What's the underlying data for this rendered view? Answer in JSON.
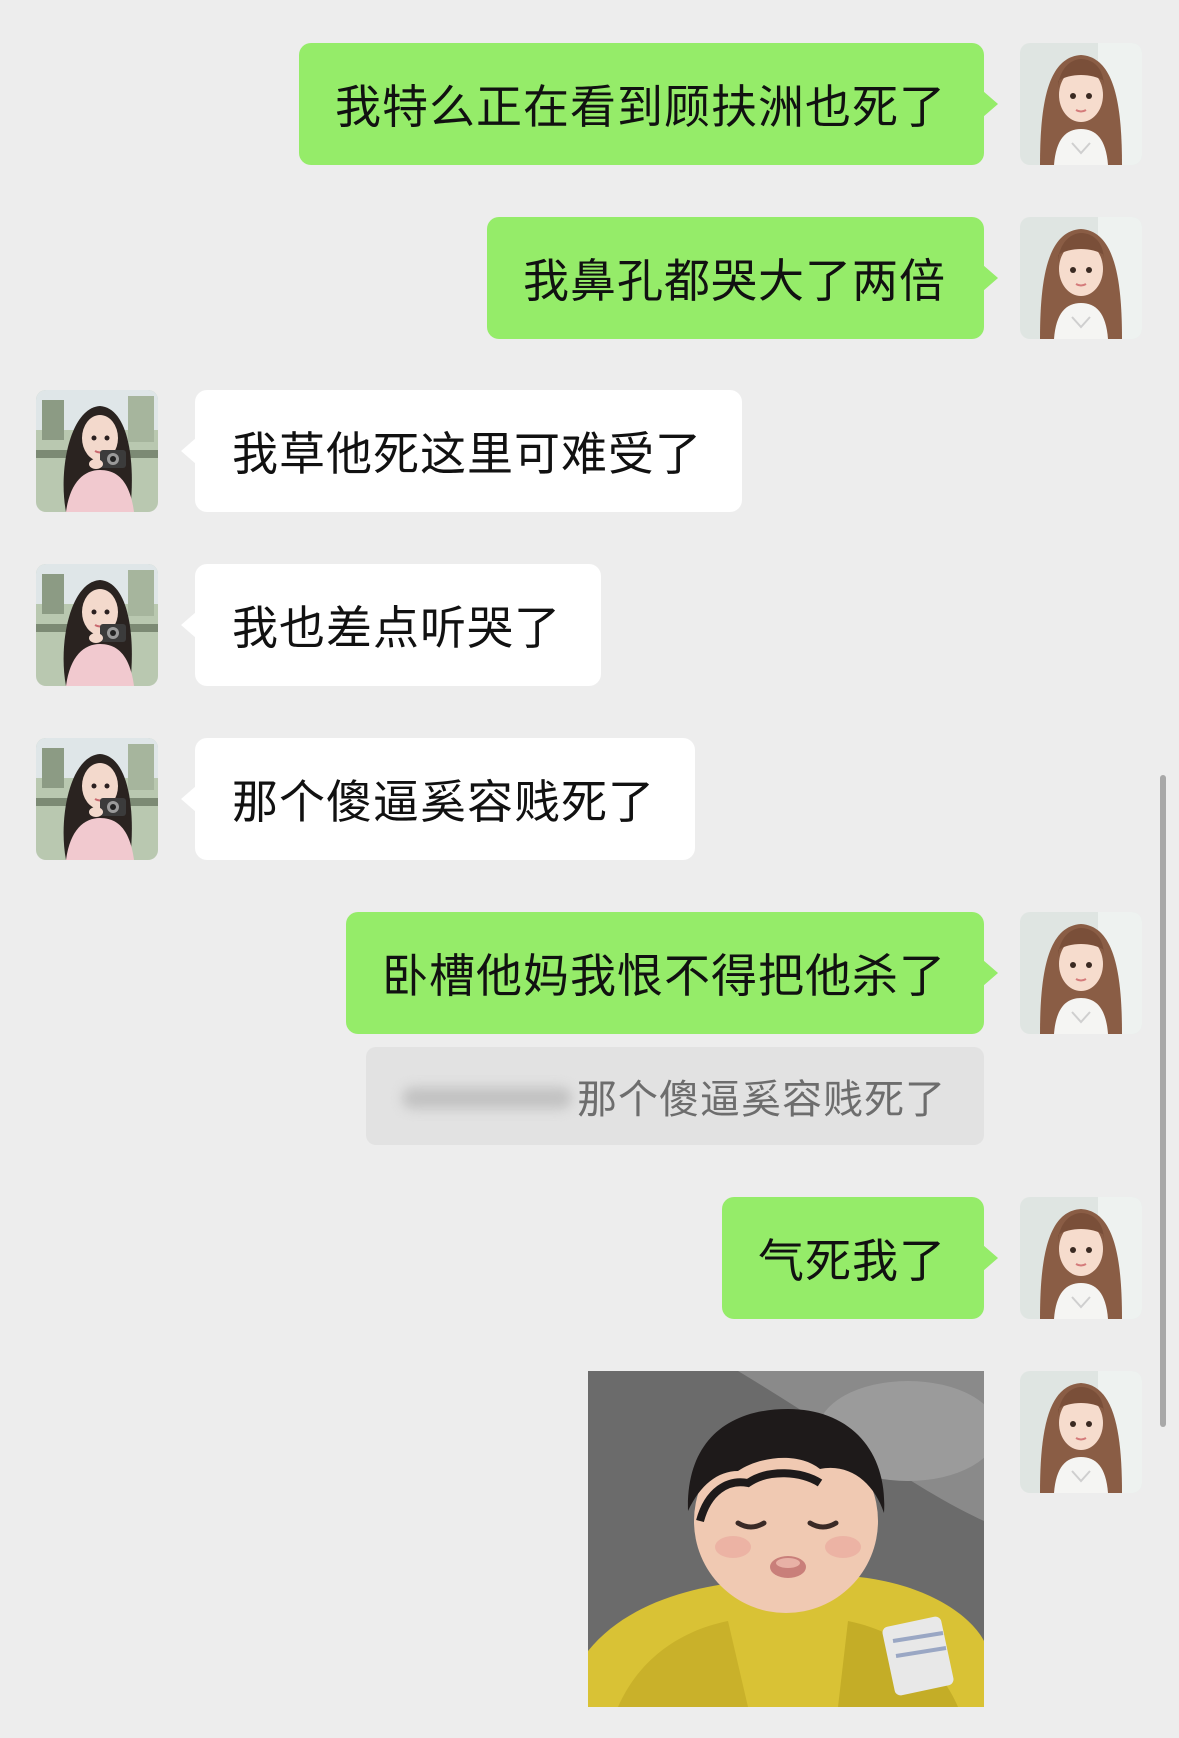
{
  "messages": [
    {
      "side": "me",
      "text": "我特么正在看到顾扶洲也死了"
    },
    {
      "side": "me",
      "text": "我鼻孔都哭大了两倍"
    },
    {
      "side": "them",
      "text": "我草他死这里可难受了"
    },
    {
      "side": "them",
      "text": "我也差点听哭了"
    },
    {
      "side": "them",
      "text": "那个傻逼奚容贱死了"
    },
    {
      "side": "me",
      "text": "卧槽他妈我恨不得把他杀了"
    },
    {
      "side": "me",
      "text": "气死我了"
    }
  ],
  "quote": {
    "text": "那个傻逼奚容贱死了"
  },
  "sticker": {
    "icon": "crying-toddler-sticker"
  },
  "colors": {
    "my_bubble": "#95ec69",
    "their_bubble": "#ffffff",
    "background": "#ededed"
  }
}
